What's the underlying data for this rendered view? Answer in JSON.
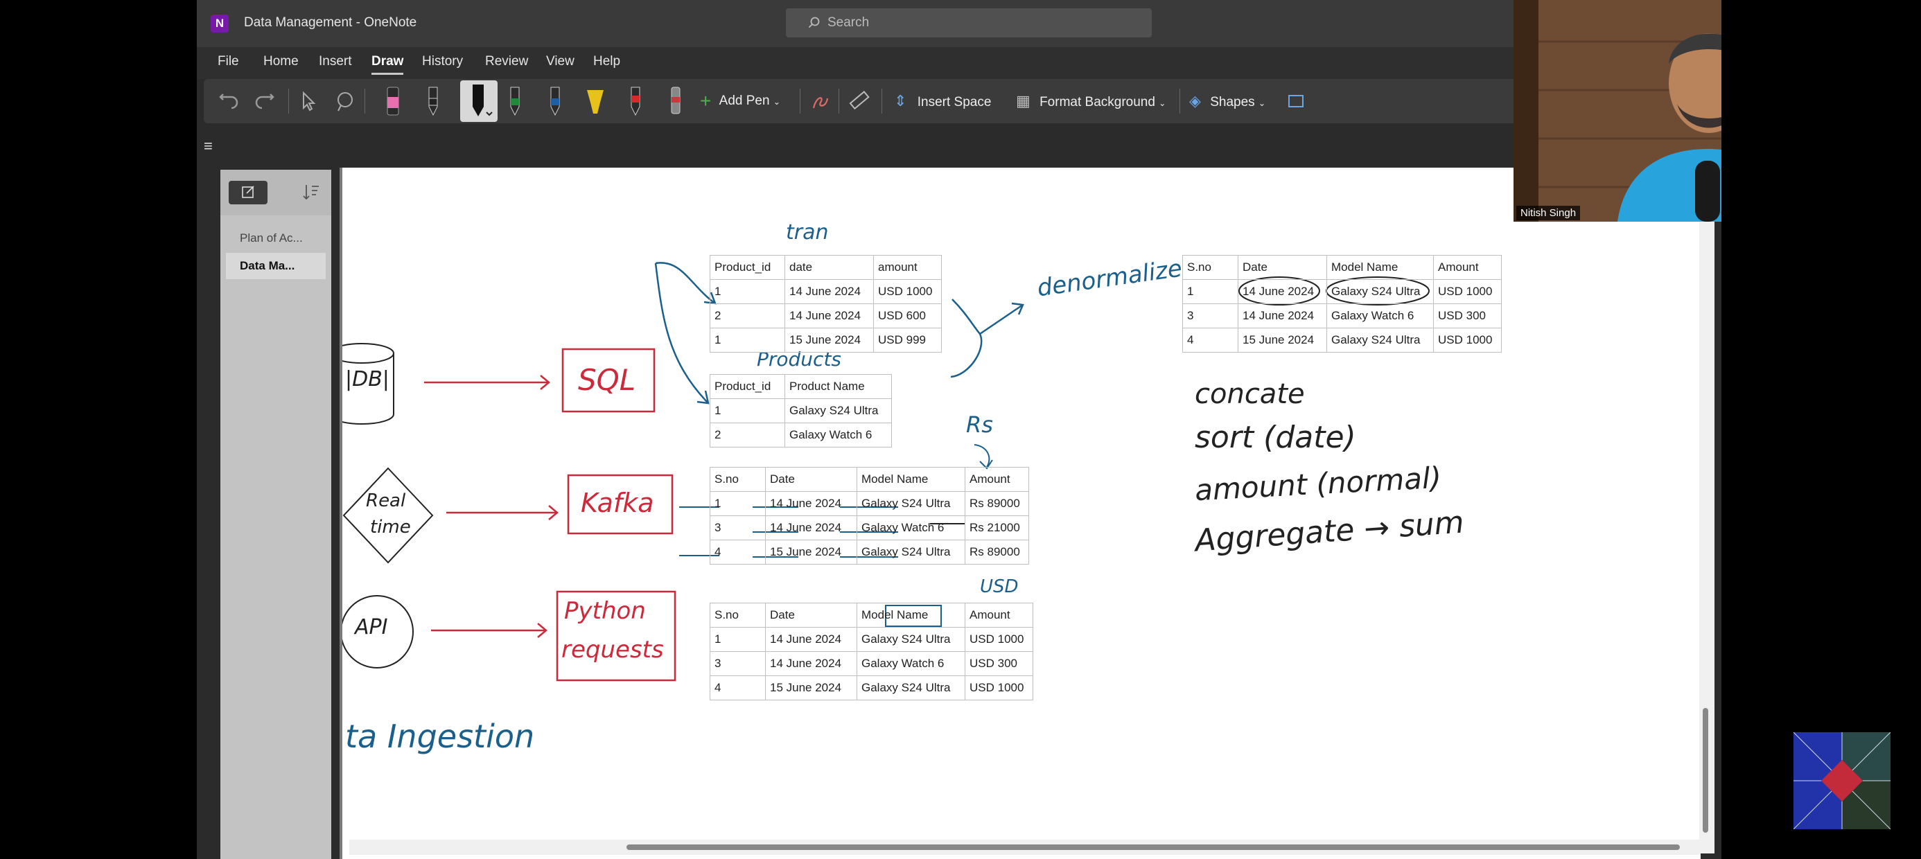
{
  "window": {
    "title": "Data Management - OneNote",
    "app_icon": "onenote-logo"
  },
  "search": {
    "placeholder": "Search"
  },
  "menu": [
    "File",
    "Home",
    "Insert",
    "Draw",
    "History",
    "Review",
    "View",
    "Help"
  ],
  "active_menu": "Draw",
  "ribbon": {
    "add_pen": "Add Pen",
    "insert_space": "Insert Space",
    "format_background": "Format Background",
    "shapes": "Shapes"
  },
  "pen_colors": [
    "#e86fb0",
    "#222222",
    "#111111",
    "#1f8a3a",
    "#1b5fa8",
    "#e8c21b",
    "#d62b2b",
    "#c83a3a"
  ],
  "nav": {
    "pages": [
      {
        "label": "Plan of Ac..."
      },
      {
        "label": "Data Ma..."
      }
    ]
  },
  "tables": {
    "transactions": {
      "headers": [
        "Product_id",
        "date",
        "amount"
      ],
      "rows": [
        [
          "1",
          "14 June 2024",
          "USD 1000"
        ],
        [
          "2",
          "14 June 2024",
          "USD 600"
        ],
        [
          "1",
          "15 June 2024",
          "USD 999"
        ]
      ]
    },
    "products": {
      "headers": [
        "Product_id",
        "Product Name"
      ],
      "rows": [
        [
          "1",
          "Galaxy S24 Ultra"
        ],
        [
          "2",
          "Galaxy Watch 6"
        ]
      ]
    },
    "kafka": {
      "headers": [
        "S.no",
        "Date",
        "Model Name",
        "Amount"
      ],
      "rows": [
        [
          "1",
          "14 June 2024",
          "Galaxy S24 Ultra",
          "Rs 89000"
        ],
        [
          "3",
          "14 June 2024",
          "Galaxy Watch 6",
          "Rs 21000"
        ],
        [
          "4",
          "15 June 2024",
          "Galaxy S24 Ultra",
          "Rs 89000"
        ]
      ]
    },
    "api": {
      "headers": [
        "S.no",
        "Date",
        "Model Name",
        "Amount"
      ],
      "rows": [
        [
          "1",
          "14 June 2024",
          "Galaxy S24 Ultra",
          "USD 1000"
        ],
        [
          "3",
          "14 June 2024",
          "Galaxy Watch 6",
          "USD 300"
        ],
        [
          "4",
          "15 June 2024",
          "Galaxy S24 Ultra",
          "USD 1000"
        ]
      ]
    },
    "result": {
      "headers": [
        "S.no",
        "Date",
        "Model Name",
        "Amount"
      ],
      "rows": [
        [
          "1",
          "14 June 2024",
          "Galaxy S24 Ultra",
          "USD 1000"
        ],
        [
          "3",
          "14 June 2024",
          "Galaxy Watch 6",
          "USD 300"
        ],
        [
          "4",
          "15 June 2024",
          "Galaxy S24 Ultra",
          "USD 1000"
        ]
      ]
    }
  },
  "ink": {
    "tran": "tran",
    "products": "Products",
    "denormalize": "denormalize",
    "rs": "Rs",
    "usd": "USD",
    "db": "|DB|",
    "sql": "SQL",
    "kafka": "Kafka",
    "realtime_1": "Real",
    "realtime_2": "time",
    "api": "API",
    "python_1": "Python",
    "python_2": "requests",
    "ingestion": "ta Ingestion",
    "steps": [
      "concate",
      "sort (date)",
      "amount (normal)",
      "Aggregate → sum"
    ]
  },
  "video": {
    "presenter": "Nitish Singh"
  },
  "colors": {
    "ink_blue": "#1b5f8c",
    "ink_red": "#cc2a3a",
    "onenote_purple": "#7719aa"
  }
}
